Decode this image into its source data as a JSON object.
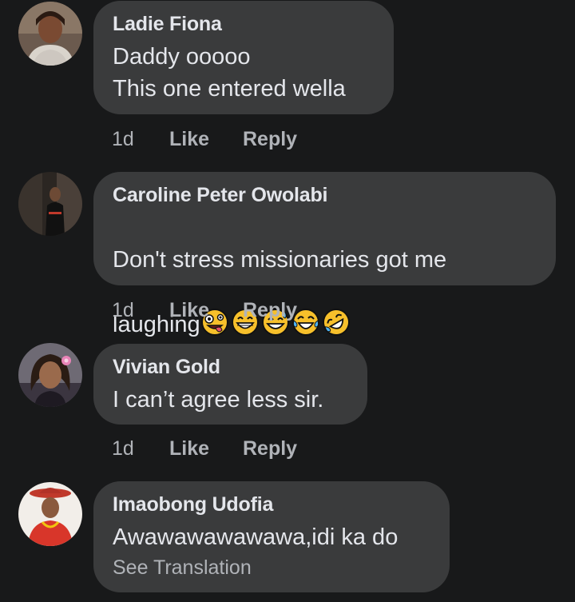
{
  "comments": [
    {
      "author": "Ladie Fiona",
      "text": "Daddy ooooo\nThis one entered wella",
      "time": "1d",
      "like_label": "Like",
      "reply_label": "Reply"
    },
    {
      "author": "Caroline Peter Owolabi",
      "text_line1": "Don't stress missionaries got me",
      "text_line2": "laughing",
      "emojis": [
        "zany-face-emoji",
        "grinning-face-emoji",
        "sweat-smile-emoji",
        "tears-of-joy-emoji",
        "rofl-emoji"
      ],
      "time": "1d",
      "like_label": "Like",
      "reply_label": "Reply"
    },
    {
      "author": "Vivian Gold",
      "text": "I can’t agree less sir.",
      "time": "1d",
      "like_label": "Like",
      "reply_label": "Reply"
    },
    {
      "author": "Imaobong Udofia",
      "text": "Awawawawawawa,idi ka do",
      "see_translation": "See Translation"
    }
  ],
  "colors": {
    "background": "#18191a",
    "bubble": "#3a3b3c",
    "primary_text": "#e4e6eb",
    "secondary_text": "#b0b3b8",
    "emoji_yellow": "#f7c02b"
  }
}
